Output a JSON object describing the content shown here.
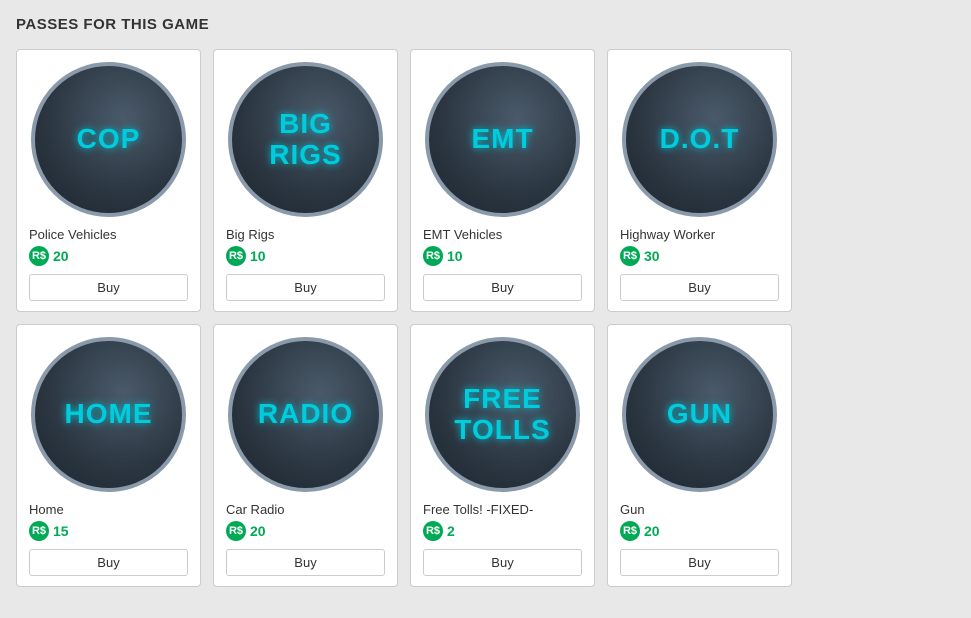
{
  "page": {
    "title": "PASSES FOR THIS GAME"
  },
  "passes": [
    {
      "id": "cop",
      "circle_text": "COP",
      "name": "Police Vehicles",
      "price": "20",
      "buy_label": "Buy"
    },
    {
      "id": "big-rigs",
      "circle_text": "BIG\nRIGS",
      "name": "Big Rigs",
      "price": "10",
      "buy_label": "Buy"
    },
    {
      "id": "emt",
      "circle_text": "EMT",
      "name": "EMT Vehicles",
      "price": "10",
      "buy_label": "Buy"
    },
    {
      "id": "dot",
      "circle_text": "D.O.T",
      "name": "Highway Worker",
      "price": "30",
      "buy_label": "Buy"
    },
    {
      "id": "home",
      "circle_text": "HOME",
      "name": "Home",
      "price": "15",
      "buy_label": "Buy"
    },
    {
      "id": "radio",
      "circle_text": "RADIO",
      "name": "Car Radio",
      "price": "20",
      "buy_label": "Buy"
    },
    {
      "id": "free-tolls",
      "circle_text": "FREE\nTOLLS",
      "name": "Free Tolls! -FIXED-",
      "price": "2",
      "buy_label": "Buy"
    },
    {
      "id": "gun",
      "circle_text": "GUN",
      "name": "Gun",
      "price": "20",
      "buy_label": "Buy"
    }
  ],
  "robux_symbol": "R$"
}
